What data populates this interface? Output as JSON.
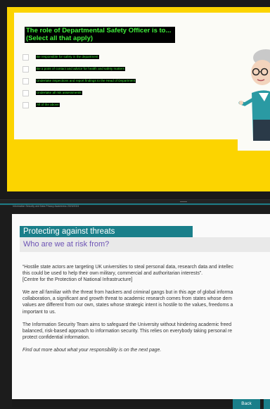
{
  "quiz": {
    "question_line1": "The role of Departmental Safety Officer is to...",
    "question_line2": "(Select all that apply)",
    "options": [
      "Be responsible for safety in the department",
      "Be a point of contact and advice for health and safety matters",
      "Undertake inspections and report findings to the Head of Department",
      "Undertake all risk assessments",
      "All of the above"
    ]
  },
  "footer_note": "Information Security and Data Privacy Awareness 2023/2024",
  "section": {
    "title": "Protecting against threats",
    "subtitle": "Who are we at risk from?"
  },
  "body": {
    "p1_line1": "“Hostile state actors are targeting UK universities to steal personal data, research data and intellec",
    "p1_line2": "this could be used to help their own military, commercial and authoritarian interests”.",
    "p1_line3": "[Centre for the Protection of National Infrastructure]",
    "p2_line1": "We are all familiar with the threat from hackers and criminal gangs but in this age of global informa",
    "p2_line2": "collaboration, a significant and growth threat to academic research comes from states whose dem",
    "p2_line3": "values are different from our own, states whose strategic intent is hostile to the values, freedoms a",
    "p2_line4": "important to us.",
    "p3_line1": "The Information Security Team aims to safeguard the University without hindering academic freed",
    "p3_line2": "balanced, risk-based approach to information security. This relies on everybody taking personal re",
    "p3_line3": "protect confidential information.",
    "p4": "Find out more about what your responsibility is on the next page."
  },
  "nav": {
    "back_label": "Back"
  },
  "colors": {
    "accent_yellow": "#fcd400",
    "teal": "#1a7f8a",
    "purple_subtitle": "#6d54b5",
    "option_text_green": "#3ff03a"
  }
}
